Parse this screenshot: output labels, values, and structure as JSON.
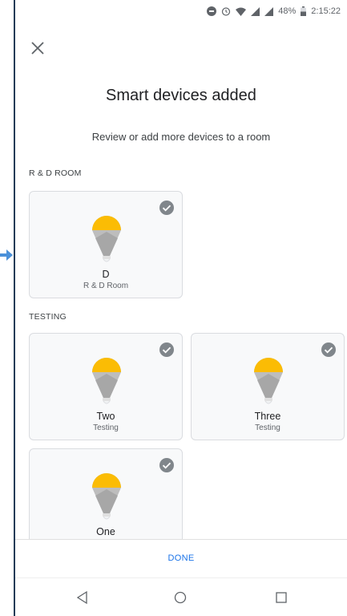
{
  "status_bar": {
    "battery": "48%",
    "time": "2:15:22"
  },
  "title": "Smart devices added",
  "subtitle": "Review or add more devices to a room",
  "sections": [
    {
      "label": "R & D ROOM"
    },
    {
      "label": "TESTING"
    }
  ],
  "devices": [
    {
      "name": "D",
      "room": "R & D Room",
      "selected": true
    },
    {
      "name": "Two",
      "room": "Testing",
      "selected": true
    },
    {
      "name": "Three",
      "room": "Testing",
      "selected": true
    },
    {
      "name": "One",
      "room": "",
      "selected": true
    }
  ],
  "done_label": "DONE",
  "colors": {
    "bulb_light": "#fbbc04",
    "bulb_body": "#bdbdbd",
    "check_bg": "#80868b",
    "accent": "#1a73e8"
  },
  "icons": [
    "close-icon",
    "check-icon",
    "bulb-icon",
    "back-icon",
    "home-icon",
    "recents-icon",
    "wifi-icon",
    "signal-icon",
    "battery-icon",
    "alarm-icon",
    "dnd-icon"
  ]
}
